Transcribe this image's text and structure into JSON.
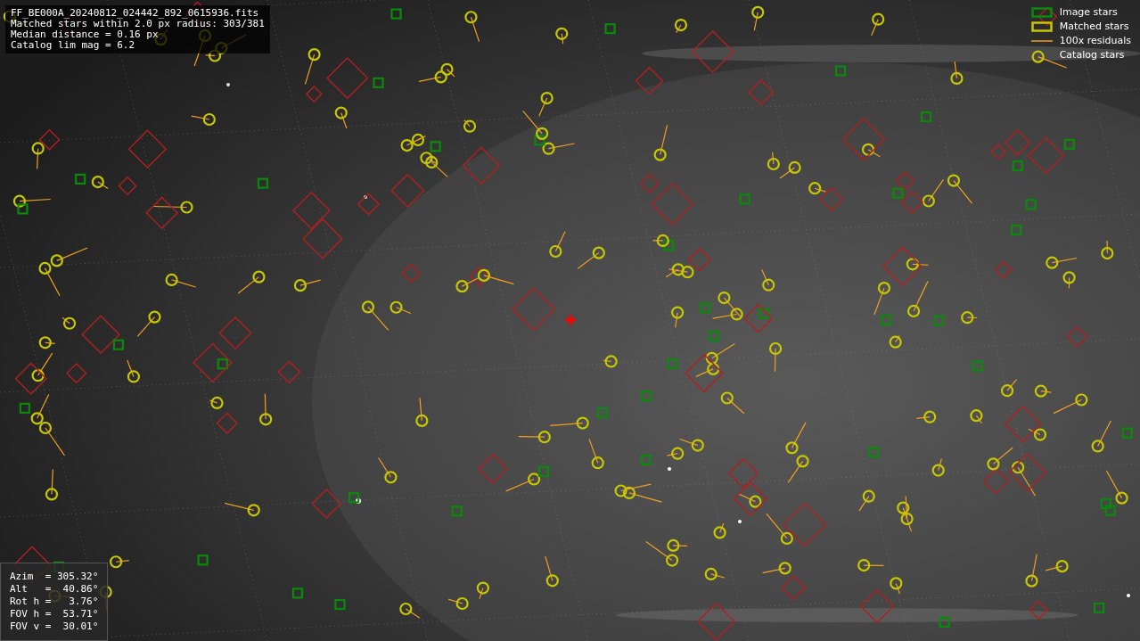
{
  "file_info": {
    "lines": [
      "FF_BE000A_20240812_024442_892_0615936.fits",
      "Matched stars within 2.0 px radius: 303/381",
      "Median distance = 0.16 px",
      "Catalog lim mag = 6.2"
    ]
  },
  "legend": {
    "items": [
      {
        "label": "Image stars"
      },
      {
        "label": "Matched stars",
        "kind": "matched"
      },
      {
        "label": "100x residuals",
        "kind": "residual"
      },
      {
        "label": "Catalog stars",
        "kind": "catalog"
      }
    ]
  },
  "pointing": {
    "lines": [
      "Azim  = 305.32°",
      "Alt   =  40.86°",
      "Rot h =   3.76°",
      "FOV h =  53.71°",
      "FOV v =  30.01°"
    ]
  }
}
